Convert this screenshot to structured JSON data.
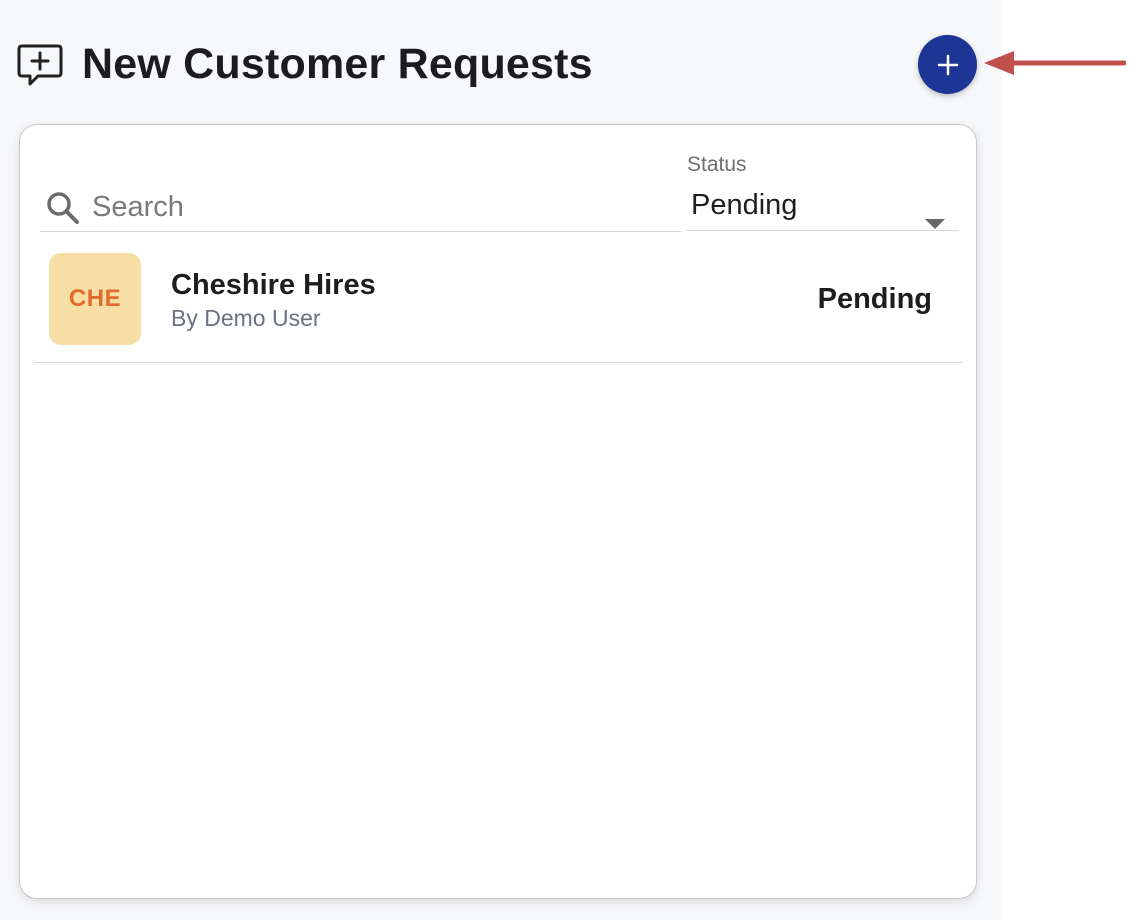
{
  "header": {
    "title": "New Customer Requests",
    "icon": "message-plus-icon",
    "add_button_icon": "plus-icon"
  },
  "annotation": {
    "arrow_color": "#c0504d"
  },
  "filters": {
    "search": {
      "placeholder": "Search",
      "value": ""
    },
    "status": {
      "label": "Status",
      "selected": "Pending"
    }
  },
  "requests": [
    {
      "initials": "CHE",
      "name": "Cheshire Hires",
      "subtitle": "By Demo User",
      "status": "Pending"
    }
  ],
  "colors": {
    "accent": "#1d3595",
    "avatar_bg": "#f7dea4",
    "avatar_text": "#e36a2d"
  }
}
